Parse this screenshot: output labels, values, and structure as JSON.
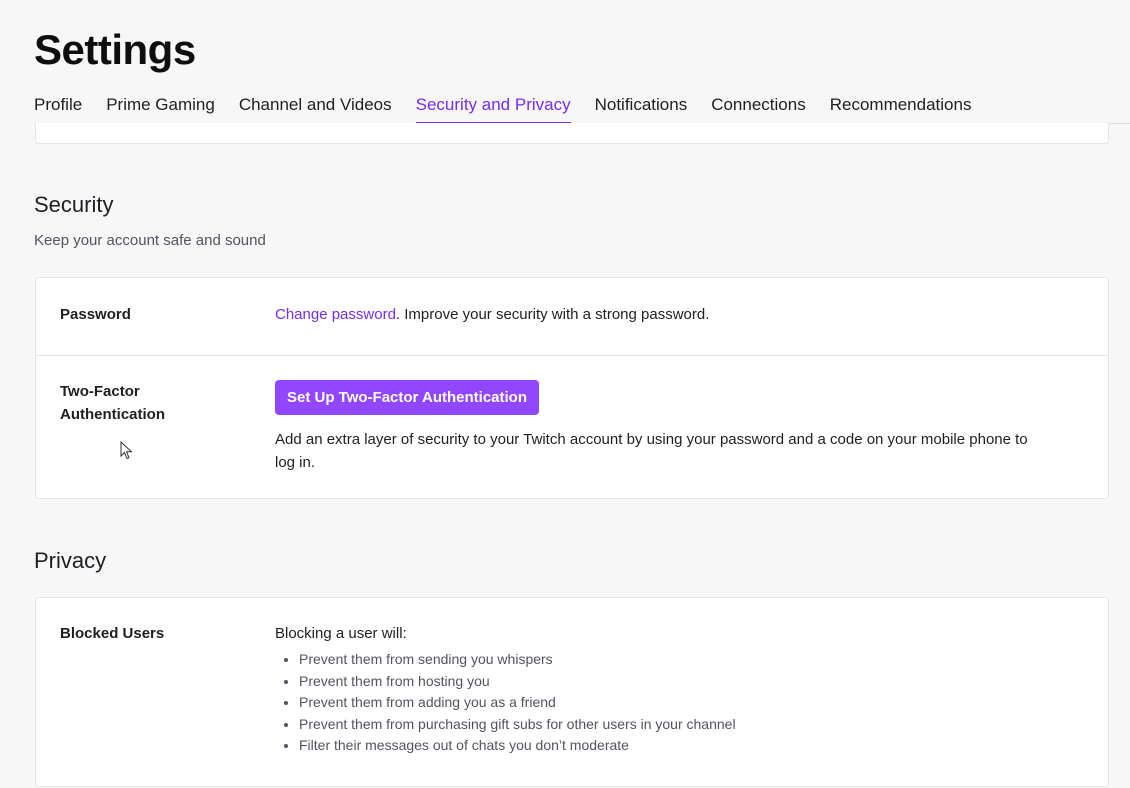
{
  "page": {
    "title": "Settings"
  },
  "tabs": [
    {
      "label": "Profile",
      "active": false
    },
    {
      "label": "Prime Gaming",
      "active": false
    },
    {
      "label": "Channel and Videos",
      "active": false
    },
    {
      "label": "Security and Privacy",
      "active": true
    },
    {
      "label": "Notifications",
      "active": false
    },
    {
      "label": "Connections",
      "active": false
    },
    {
      "label": "Recommendations",
      "active": false
    }
  ],
  "security": {
    "title": "Security",
    "description": "Keep your account safe and sound",
    "password": {
      "label": "Password",
      "link": "Change password",
      "text": ". Improve your security with a strong password."
    },
    "two_factor": {
      "label_line1": "Two-Factor",
      "label_line2": "Authentication",
      "button": "Set Up Two-Factor Authentication",
      "description": "Add an extra layer of security to your Twitch account by using your password and a code on your mobile phone to log in."
    }
  },
  "privacy": {
    "title": "Privacy",
    "blocked_users": {
      "label": "Blocked Users",
      "intro": "Blocking a user will:",
      "items": [
        "Prevent them from sending you whispers",
        "Prevent them from hosting you",
        "Prevent them from adding you as a friend",
        "Prevent them from purchasing gift subs for other users in your channel",
        "Filter their messages out of chats you don’t moderate"
      ]
    }
  },
  "colors": {
    "accent": "#9147ff",
    "link": "#772ce8",
    "background": "#f7f7f8"
  },
  "icons": {
    "cursor": "mouse-pointer-icon"
  }
}
